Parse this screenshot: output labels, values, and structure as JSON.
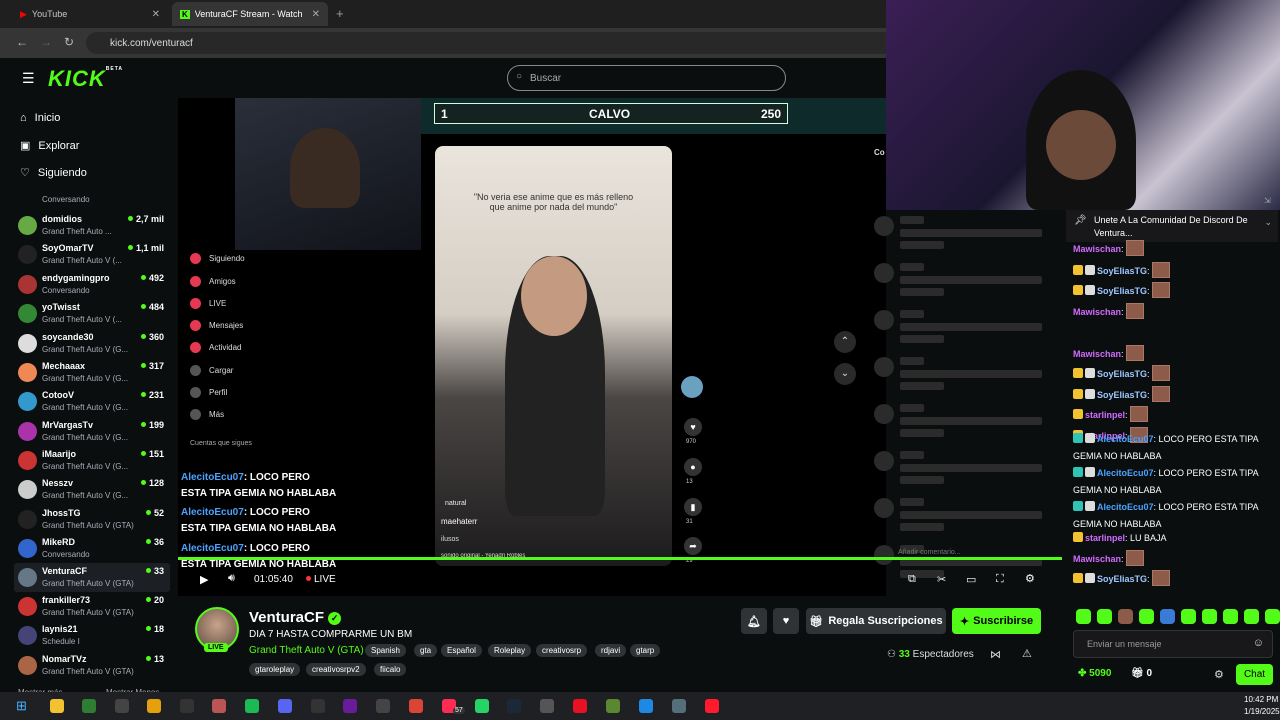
{
  "browser": {
    "tab1": "YouTube",
    "tab2": "VenturaCF Stream - Watch Live",
    "url": "kick.com/venturacf"
  },
  "header": {
    "logo": "KICK",
    "logo_sup": "BETA",
    "search_placeholder": "Buscar"
  },
  "nav": {
    "home": "Inicio",
    "explore": "Explorar",
    "following": "Siguiendo"
  },
  "channels": [
    {
      "name": "",
      "game": "Conversando",
      "viewers": "",
      "color": "#555"
    },
    {
      "name": "domidios",
      "game": "Grand Theft Auto ...",
      "viewers": "2,7 mil",
      "color": "#6a4"
    },
    {
      "name": "SoyOmarTV",
      "game": "Grand Theft Auto V (...",
      "viewers": "1,1 mil",
      "color": "#222"
    },
    {
      "name": "endygamingpro",
      "game": "Conversando",
      "viewers": "492",
      "color": "#a33"
    },
    {
      "name": "yoTwisst",
      "game": "Grand Theft Auto V (...",
      "viewers": "484",
      "color": "#383"
    },
    {
      "name": "soycande30",
      "game": "Grand Theft Auto V (G...",
      "viewers": "360",
      "color": "#ddd"
    },
    {
      "name": "Mechaaax",
      "game": "Grand Theft Auto V (G...",
      "viewers": "317",
      "color": "#e85"
    },
    {
      "name": "CotooV",
      "game": "Grand Theft Auto V (G...",
      "viewers": "231",
      "color": "#39c"
    },
    {
      "name": "MrVargasTv",
      "game": "Grand Theft Auto V (G...",
      "viewers": "199",
      "color": "#a3a"
    },
    {
      "name": "iMaarijo",
      "game": "Grand Theft Auto V (G...",
      "viewers": "151",
      "color": "#c33"
    },
    {
      "name": "Nesszv",
      "game": "Grand Theft Auto V (G...",
      "viewers": "128",
      "color": "#ccc"
    },
    {
      "name": "JhossTG",
      "game": "Grand Theft Auto V (GTA)",
      "viewers": "52",
      "color": "#222"
    },
    {
      "name": "MikeRD",
      "game": "Conversando",
      "viewers": "36",
      "color": "#36c"
    },
    {
      "name": "VenturaCF",
      "game": "Grand Theft Auto V (GTA)",
      "viewers": "33",
      "color": "#678"
    },
    {
      "name": "frankiller73",
      "game": "Grand Theft Auto V (GTA)",
      "viewers": "20",
      "color": "#c33"
    },
    {
      "name": "laynis21",
      "game": "Schedule I",
      "viewers": "18",
      "color": "#447"
    },
    {
      "name": "NomarTVz",
      "game": "Grand Theft Auto V (GTA)",
      "viewers": "13",
      "color": "#a64"
    }
  ],
  "sidebar_footer": {
    "more": "Mostrar más",
    "less": "Mostrar Menos"
  },
  "video": {
    "score_rank": "1",
    "score_name": "CALVO",
    "score_value": "250",
    "tiktok_caption": "\"No veria ese anime que es más relleno que anime por nada del mundo\"",
    "tiktok_user": "maehaterr",
    "tiktok_sound": "sonido original - Yenadri Robles",
    "tiktok_tag": "natural",
    "tiktok_more": "ilusos",
    "tiktok_counts": [
      "970",
      "13",
      "31",
      "29"
    ],
    "tiktok_menu": [
      "Siguiendo",
      "Amigos",
      "LIVE",
      "Mensajes",
      "Actividad",
      "Cargar",
      "Perfil",
      "Más"
    ],
    "tiktok_accounts": "Cuentas que sigues",
    "comment_placeholder": "Añadir comentario...",
    "side_label": "Co",
    "overlay_user": "AlecitoEcu07",
    "overlay_text": ": LOCO PERO",
    "overlay_text2": "ESTA TIPA GEMIA NO HABLABA",
    "time": "01:05:40",
    "live": "LIVE"
  },
  "stream": {
    "channel": "VenturaCF",
    "title": "DIA 7 HASTA COMPRARME UN BM",
    "category": "Grand Theft Auto V (GTA)",
    "live": "LIVE",
    "tags": [
      "Spanish",
      "gta",
      "Español",
      "Roleplay",
      "creativosrp",
      "rdjavi",
      "gtarp",
      "gtaroleplay",
      "creativosrpv2",
      "fiicalo"
    ],
    "gift_button": "Regala Suscripciones",
    "subscribe_button": "Suscribirse",
    "viewers": "33",
    "viewers_label": "Espectadores"
  },
  "chat": {
    "pinned": "Unete A La Comunidad De Discord De Ventura...",
    "messages": [
      {
        "user": "Mawischan",
        "text": "",
        "color": "#d36bff",
        "badges": 0
      },
      {
        "user": "SoyEliasTG",
        "text": "",
        "color": "#9ec7ff",
        "badges": 2
      },
      {
        "user": "SoyEliasTG",
        "text": "",
        "color": "#9ec7ff",
        "badges": 2
      },
      {
        "user": "Mawischan",
        "text": "",
        "color": "#d36bff",
        "badges": 0
      },
      {
        "user": "Mawischan",
        "text": "",
        "color": "#d36bff",
        "badges": 0
      },
      {
        "user": "SoyEliasTG",
        "text": "",
        "color": "#9ec7ff",
        "badges": 2
      },
      {
        "user": "SoyEliasTG",
        "text": "",
        "color": "#9ec7ff",
        "badges": 2
      },
      {
        "user": "starlinpel",
        "text": "",
        "color": "#d36bff",
        "badges": 1
      },
      {
        "user": "starlinpel",
        "text": "",
        "color": "#d36bff",
        "badges": 1
      },
      {
        "user": "AlecitoEcu07",
        "text": "LOCO PERO ESTA TIPA GEMIA NO HABLABA",
        "color": "#4aa3ff",
        "badges": 2
      },
      {
        "user": "AlecitoEcu07",
        "text": "LOCO PERO ESTA TIPA GEMIA NO HABLABA",
        "color": "#4aa3ff",
        "badges": 2
      },
      {
        "user": "AlecitoEcu07",
        "text": "LOCO PERO ESTA TIPA GEMIA NO HABLABA",
        "color": "#4aa3ff",
        "badges": 2
      },
      {
        "user": "starlinpel",
        "text": "LU BAJA",
        "color": "#d36bff",
        "badges": 1
      },
      {
        "user": "Mawischan",
        "text": "",
        "color": "#d36bff",
        "badges": 0
      },
      {
        "user": "SoyEliasTG",
        "text": "",
        "color": "#9ec7ff",
        "badges": 2
      }
    ],
    "input_placeholder": "Enviar un mensaje",
    "points": "5090",
    "gifts": "0",
    "chat_button": "Chat"
  },
  "taskbar": {
    "time": "10:42 PM",
    "date": "1/19/2025",
    "badge": "57"
  },
  "colors": {
    "accent": "#53fc18",
    "bg": "#0b0e0f"
  }
}
